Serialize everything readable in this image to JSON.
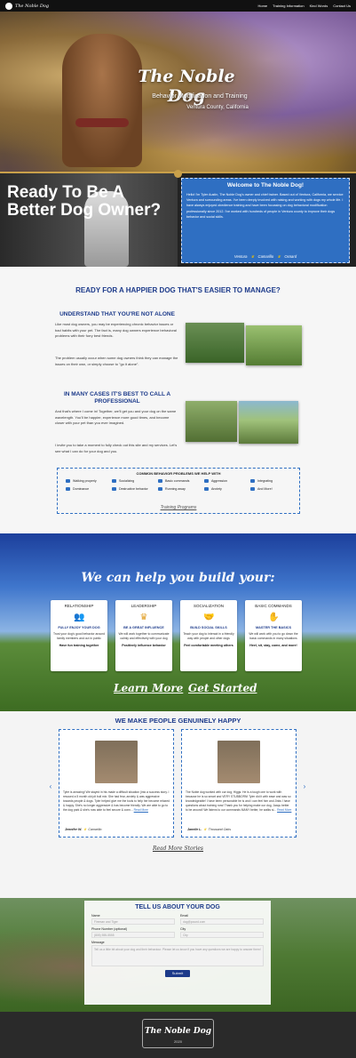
{
  "nav": {
    "logo": "The Noble Dog",
    "items": [
      "Home",
      "Training Information",
      "Kind Words",
      "Contact Us"
    ]
  },
  "hero": {
    "title": "The Noble Dog",
    "subtitle": "Behavior Modification and Training",
    "location": "Ventura County, California"
  },
  "welcome": {
    "headline": "Ready To Be A Better Dog Owner?",
    "title": "Welcome to The Noble Dog!",
    "body": "Hello! I'm Tyler Austin, The Noble Dog's owner and chief trainer. Based out of Ventura, California, we service Ventura and surrounding areas. I've been deeply involved with raising and working with dogs my whole life. I have always enjoyed obedience training and have been focussing on dog behavioral modification professionally since 2012. I've worked with hundreds of people in Ventura county to improve their dogs behavior and social skills.",
    "towns": [
      "Ventura",
      "Camarillo",
      "Oxnard"
    ]
  },
  "intro": {
    "heading": "READY FOR A HAPPIER DOG THAT'S EASIER TO MANAGE?",
    "sub1": "UNDERSTAND THAT YOU'RE NOT ALONE",
    "p1": "Like most dog owners, you may be experiencing chronic behavior issues or bad habits with your pet. The fact is, many dog owners experience behavioral problems with their furry best friends.",
    "p2": "The problem usually occur when some dog owners think they can manage the issues on their own, or simply choose to \"go it alone\".",
    "sub2": "IN MANY CASES IT'S BEST TO CALL A PROFESSIONAL",
    "p3": "And that's where I come in! Together, we'll get you and your dog on the same wavelength. You'll be happier, experience more good times, and become closer with your pet than you ever imagined.",
    "p4": "I invite you to take a moment to fully check out this site and my services. Let's see what I can do for your dog and you.",
    "problems_title": "COMMON BEHAVIOR PROBLEMS WE HELP WITH",
    "problems": [
      "Walking properly",
      "Socializing",
      "Basic commands",
      "Aggression",
      "Integrating",
      "Dominance",
      "Destructive behavior",
      "Running away",
      "Anxiety",
      "And More!"
    ],
    "link": "Training Programs"
  },
  "help": {
    "heading": "We can help you build your:",
    "cards": [
      {
        "title": "RELATIONSHIP",
        "icon": "people-icon",
        "sub": "FULLY ENJOY YOUR DOG",
        "desc": "Trust your dog's good behavior around family members and out in public",
        "bottom": "Have fun training together"
      },
      {
        "title": "LEADERSHIP",
        "icon": "crown-icon",
        "sub": "BE A GREAT INFLUENCE",
        "desc": "We will work together to communicate calmly and effectively with your dog",
        "bottom": "Positively influence behavior"
      },
      {
        "title": "SOCIALIZATION",
        "icon": "handshake-icon",
        "sub": "BUILD SOCIAL SKILLS",
        "desc": "Teach your dog to interact in a friendly way with people and other dogs",
        "bottom": "Feel comfortable meeting others"
      },
      {
        "title": "BASIC COMMANDS",
        "icon": "hand-icon",
        "sub": "MASTER THE BASICS",
        "desc": "We will work with you to go down the basic commands in many situations",
        "bottom": "Heel, sit, stay, come, and more!"
      }
    ],
    "cta_learn": "Learn More",
    "cta_start": "Get Started"
  },
  "testimonials": {
    "heading": "WE MAKE PEOPLE GENUINELY HAPPY",
    "items": [
      {
        "text": "Tyler is amazing! We stayed in his made a difficult situation (into a success story. I rescued a 5 month old pit bull mix. She had fear, anxiety & was aggressive towards people & dogs. Tyler helped give me the tools to help her become relaxed & happy. She's no longer aggressive & has become friendly. We are able to go to the dog park & she's now able to feel secure & conn...",
        "read": "Read More",
        "author": "Jennifer W.",
        "town": "Camarillo"
      },
      {
        "text": "The Noble dog worked with our dog, Higgs. He is a tough one to work with because he is so smart and VERY STUBBORN! Tyler did it with ease and was so knowledgeable! I have been personable he is and I can feel him and Jinks I have questions about training now! Thank you for helping make our dog, Jaxqu better to be around! We listens to our commands MANY better, he walks si...",
        "read": "Read More",
        "author": "Janelle L.",
        "town": "Thousand Oaks"
      }
    ],
    "more": "Read More Stories"
  },
  "contact": {
    "heading": "TELL US ABOUT YOUR DOG",
    "name_label": "Name",
    "name_ph": "Fireman and Tiger",
    "email_label": "Email",
    "email_ph": "dog@pound.com",
    "phone_label": "Phone Number (optional)",
    "phone_ph": "(805) 555-5555",
    "city_label": "City",
    "city_ph": "City",
    "msg_label": "Message",
    "msg_ph": "Tell us a little bit about your dog and their behaviour. Please let us know if you have any questions we are happy to answer them!",
    "submit": "Submit"
  },
  "footer": {
    "brand": "The Noble Dog",
    "year": "2020"
  },
  "colors": {
    "accent": "#2f6fc2",
    "navy": "#1c3a8a",
    "gold": "#c9a04a"
  }
}
